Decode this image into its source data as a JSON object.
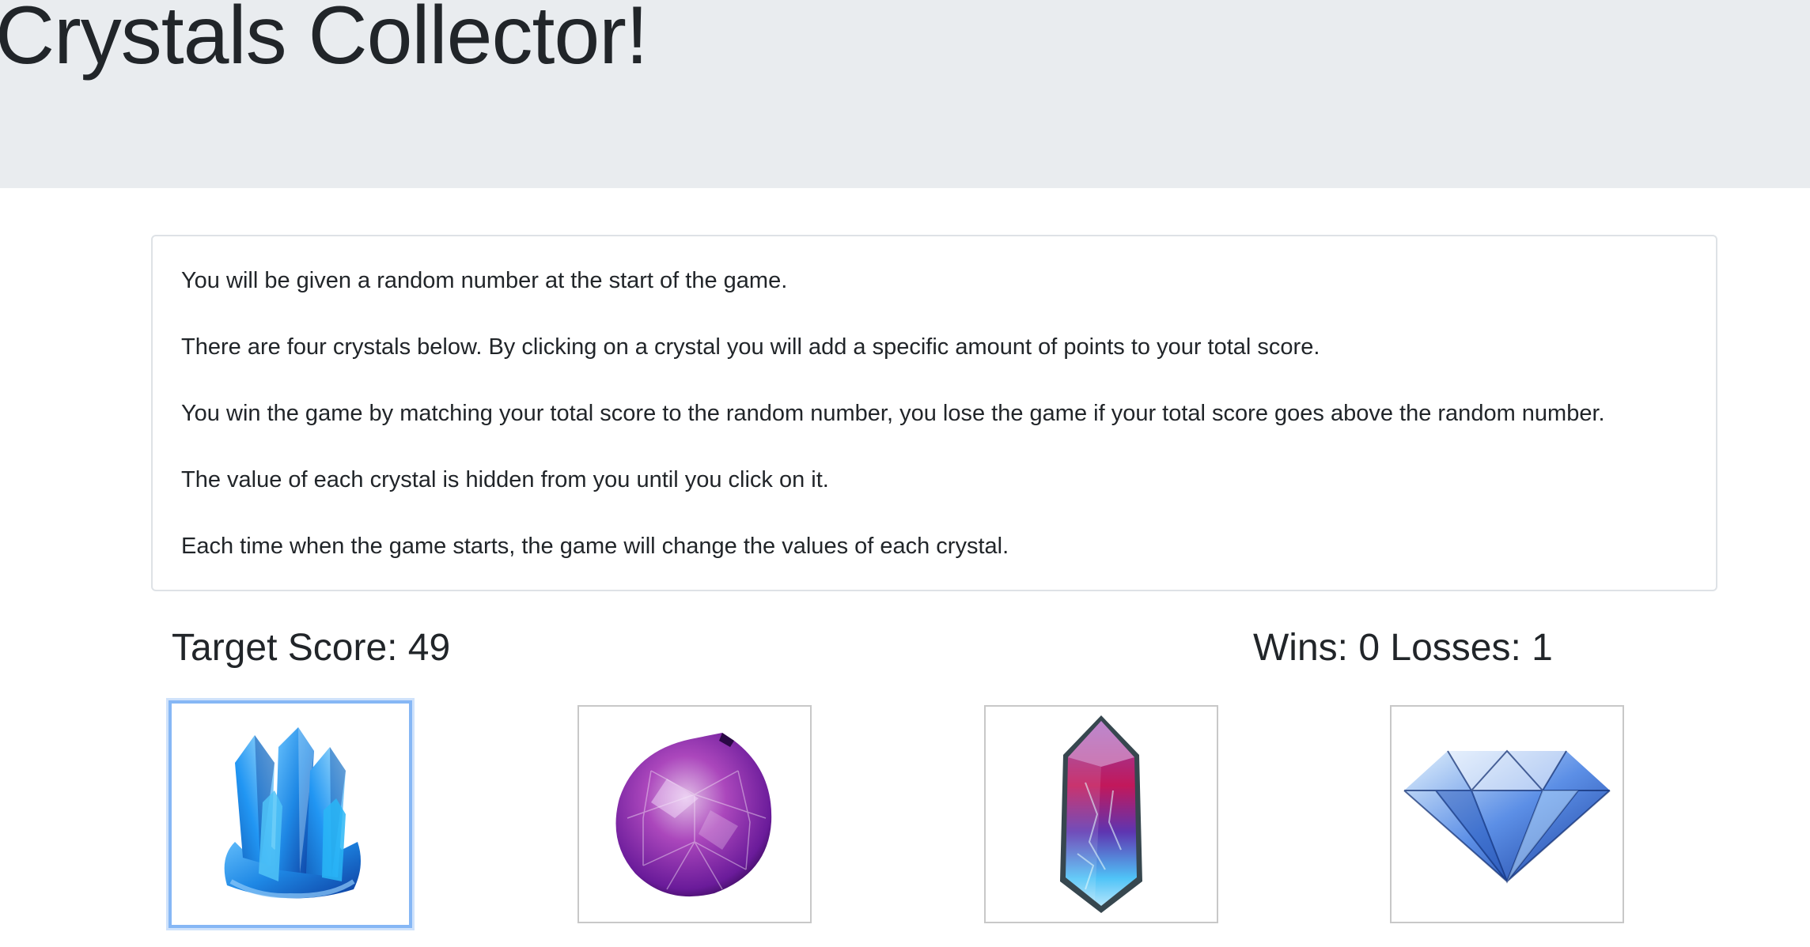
{
  "header": {
    "title": "Crystals Collector!"
  },
  "instructions": [
    "You will be given a random number at the start of the game.",
    "There are four crystals below. By clicking on a crystal you will add a specific amount of points to your total score.",
    "You win the game by matching your total score to the random number, you lose the game if your total score goes above the random number.",
    "The value of each crystal is hidden from you until you click on it.",
    "Each time when the game starts, the game will change the values of each crystal."
  ],
  "scoreboard": {
    "target_label": "Target Score: 49",
    "record_label": "Wins: 0 Losses: 1"
  },
  "crystals": [
    {
      "icon": "blue-crystal-cluster-icon",
      "color": "#1e88e5",
      "focused": true
    },
    {
      "icon": "purple-amethyst-icon",
      "color": "#8e44c9"
    },
    {
      "icon": "pink-blue-crystal-shard-icon",
      "color": "#c2185b"
    },
    {
      "icon": "diamond-icon",
      "color": "#3f6fd8"
    }
  ],
  "colors": {
    "header_bg": "#e9ecef",
    "text": "#212529",
    "border": "#dee2e6",
    "focus_ring": "#86b7f5"
  }
}
